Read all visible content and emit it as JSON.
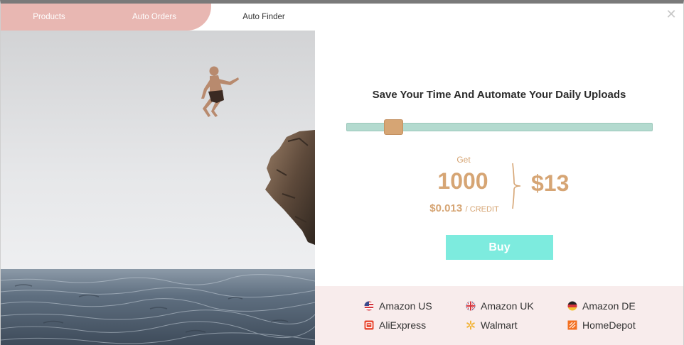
{
  "tabs": [
    {
      "label": "Products",
      "active": false
    },
    {
      "label": "Auto Orders",
      "active": false
    },
    {
      "label": "Auto Finder",
      "active": true
    }
  ],
  "close_icon": "close-icon",
  "photo": {
    "subject": "man jumping off a cliff into the sea"
  },
  "plan": {
    "headline": "Save Your Time And Automate Your Daily Uploads",
    "slider_value_fraction": 0.13,
    "get_label": "Get",
    "credits": "1000",
    "per_credit_amount": "$0.013",
    "per_credit_unit": "/ CREDIT",
    "price": "$13",
    "buy_label": "Buy"
  },
  "stores": [
    {
      "label": "Amazon US",
      "icon": "us-flag-icon"
    },
    {
      "label": "Amazon UK",
      "icon": "uk-flag-icon"
    },
    {
      "label": "Amazon DE",
      "icon": "de-flag-icon"
    },
    {
      "label": "AliExpress",
      "icon": "aliexpress-icon"
    },
    {
      "label": "Walmart",
      "icon": "walmart-icon"
    },
    {
      "label": "HomeDepot",
      "icon": "homedepot-icon"
    }
  ],
  "colors": {
    "tab_pink": "#e8b7b2",
    "accent_gold": "#d6a574",
    "slider_track": "#b3dacf",
    "buy_button": "#7debde",
    "stores_bg": "#f8ecec"
  }
}
